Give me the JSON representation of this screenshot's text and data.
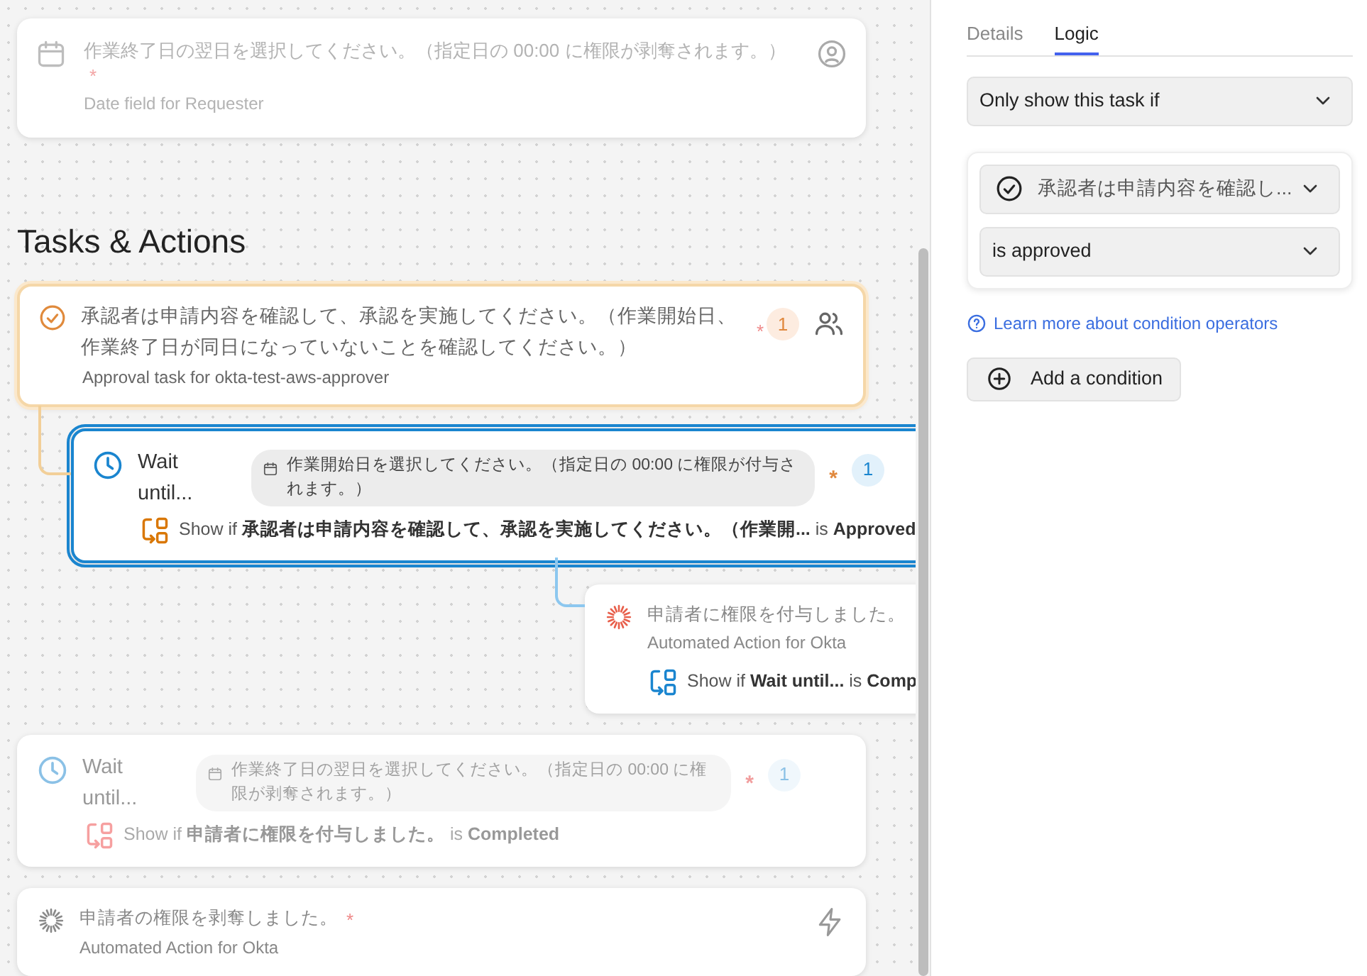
{
  "field_card": {
    "kind": "date",
    "title": "作業終了日の翌日を選択してください。（指定日の 00:00 に権限が剥奪されます。）",
    "required_mark": "*",
    "subtitle": "Date field for Requester"
  },
  "section_heading": "Tasks & Actions",
  "tasks": [
    {
      "kind": "approval",
      "title": "承認者は申請内容を確認して、承認を実施してください。（作業開始日、作業終了日が同日になっていないことを確認してください。）",
      "required_mark": "*",
      "badge": "1",
      "subtitle": "Approval task for okta-test-aws-approver",
      "highlighted": true,
      "selected": false,
      "dimmed": false,
      "children": [
        {
          "kind": "wait",
          "title": "Wait until...",
          "field_pill": "作業開始日を選択してください。（指定日の 00:00 に権限が付与されます。）",
          "required_mark": "*",
          "badge": "1",
          "condition": "Show if **承認者は申請内容を確認して、承認を実施してください。（作業開...** is **Approved**",
          "highlighted": false,
          "selected": true,
          "dimmed": false,
          "children": [
            {
              "kind": "action",
              "title": "申請者に権限を付与しました。",
              "subtitle": "Automated Action for Okta",
              "condition": "Show if **Wait until...** is **Comp**",
              "color": "#e8604c",
              "highlighted": false,
              "selected": false,
              "dimmed": false
            }
          ]
        }
      ]
    },
    {
      "kind": "wait",
      "title": "Wait until...",
      "field_pill": "作業終了日の翌日を選択してください。（指定日の 00:00 に権限が剥奪されます。）",
      "required_mark": "*",
      "badge": "1",
      "condition": "Show if **申請者に権限を付与しました。** is **Completed**",
      "highlighted": false,
      "selected": false,
      "dimmed": true
    },
    {
      "kind": "action",
      "title": "申請者の権限を剥奪しました。",
      "required_mark": "*",
      "subtitle": "Automated Action for Okta",
      "color": "#8a8a8a",
      "instant": true,
      "highlighted": false,
      "selected": false,
      "dimmed": false
    }
  ],
  "panel": {
    "tabs": [
      {
        "label": "Details",
        "selected": false
      },
      {
        "label": "Logic",
        "selected": true
      }
    ],
    "visibility_select": "Only show this task if",
    "condition": {
      "task_select": "承認者は申請内容を確認し...",
      "operator_select": "is approved"
    },
    "help_link": "Learn more about condition operators",
    "add_button": "Add a condition"
  }
}
